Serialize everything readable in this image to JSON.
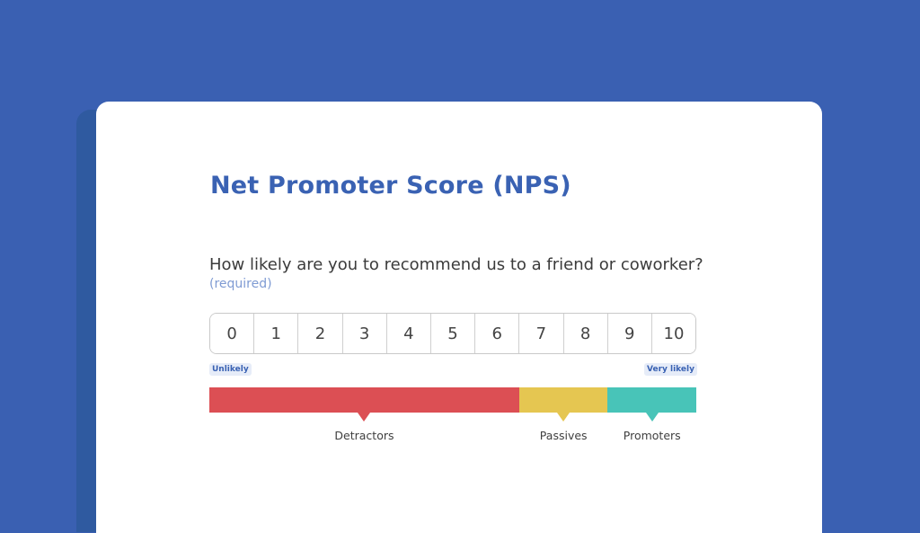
{
  "title": "Net Promoter Score (NPS)",
  "question": "How likely are you to recommend us to a friend or coworker?",
  "required_label": "(required)",
  "scale": {
    "options": [
      "0",
      "1",
      "2",
      "3",
      "4",
      "5",
      "6",
      "7",
      "8",
      "9",
      "10"
    ],
    "low_label": "Unlikely",
    "high_label": "Very likely"
  },
  "categories": [
    {
      "label": "Detractors",
      "range": "0-6",
      "count": 7,
      "color": "#dc4f54"
    },
    {
      "label": "Passives",
      "range": "7-8",
      "count": 2,
      "color": "#e5c651"
    },
    {
      "label": "Promoters",
      "range": "9-10",
      "count": 2,
      "color": "#48c4b8"
    }
  ],
  "colors": {
    "background": "#3a60b2",
    "accent": "#3a62b3",
    "card": "#ffffff"
  }
}
